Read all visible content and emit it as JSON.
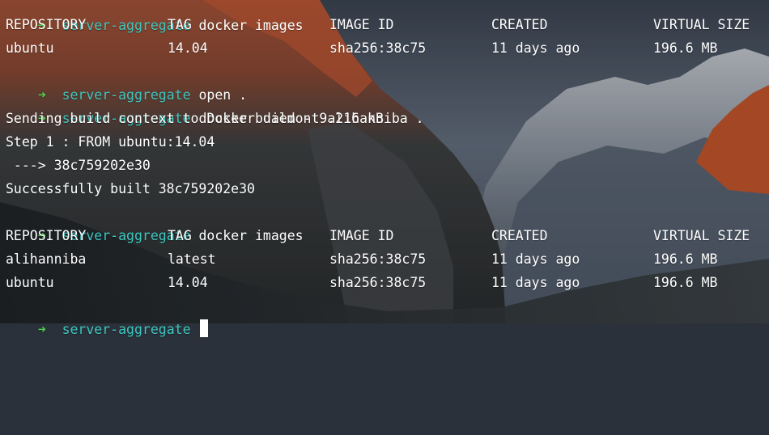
{
  "colors": {
    "prompt_arrow": "#4fd14f",
    "prompt_dir": "#3ec6c0",
    "text": "#ffffff"
  },
  "prompt": {
    "arrow": "➜",
    "dir": "server-aggregate"
  },
  "lines": {
    "l0": {
      "cmd": "docker images"
    },
    "l1": {
      "c1": "REPOSITORY",
      "c2": "TAG",
      "c3": "IMAGE ID",
      "c4": "CREATED",
      "c5": "VIRTUAL SIZE"
    },
    "l2": {
      "c1": "ubuntu",
      "c2": "14.04",
      "c3": "sha256:38c75",
      "c4": "11 days ago",
      "c5": "196.6 MB"
    },
    "l3": {
      "cmd": "open ."
    },
    "l4": {
      "cmd": "docker build -t alihanniba ."
    },
    "l5": {
      "text": "Sending build context to Docker daemon 9.216 kB"
    },
    "l6": {
      "text": "Step 1 : FROM ubuntu:14.04"
    },
    "l7": {
      "text": " ---> 38c759202e30"
    },
    "l8": {
      "text": "Successfully built 38c759202e30"
    },
    "l9": {
      "cmd": "docker images"
    },
    "l10": {
      "c1": "REPOSITORY",
      "c2": "TAG",
      "c3": "IMAGE ID",
      "c4": "CREATED",
      "c5": "VIRTUAL SIZE"
    },
    "l11": {
      "c1": "alihanniba",
      "c2": "latest",
      "c3": "sha256:38c75",
      "c4": "11 days ago",
      "c5": "196.6 MB"
    },
    "l12": {
      "c1": "ubuntu",
      "c2": "14.04",
      "c3": "sha256:38c75",
      "c4": "11 days ago",
      "c5": "196.6 MB"
    },
    "l13": {
      "cmd": ""
    }
  }
}
